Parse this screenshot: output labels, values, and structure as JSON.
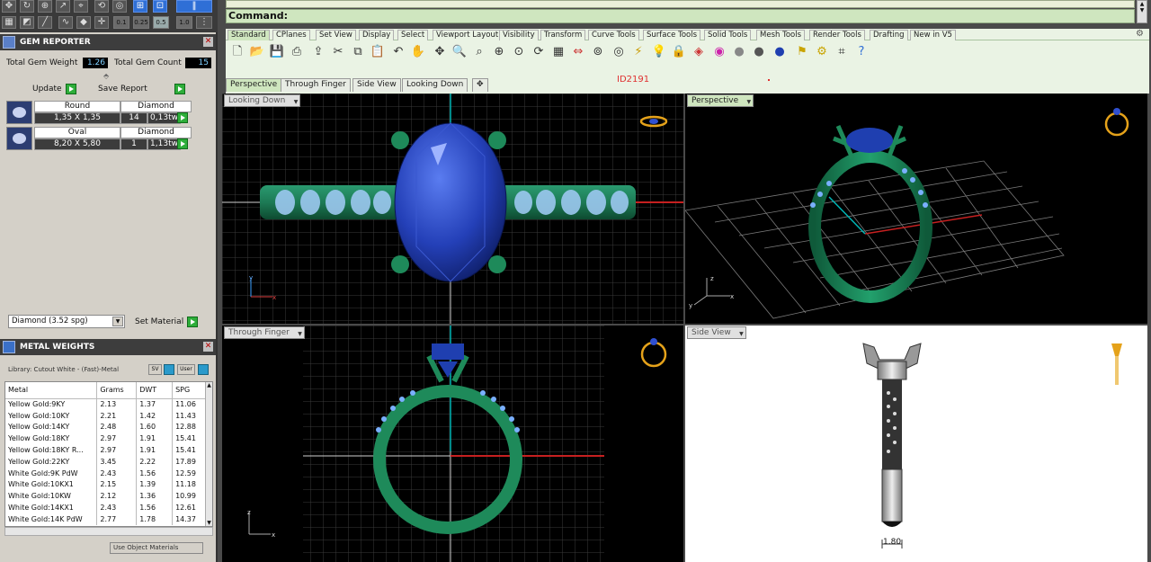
{
  "gem_reporter": {
    "title": "GEM REPORTER",
    "total_weight_label": "Total Gem Weight",
    "total_weight_value": "1.26",
    "total_count_label": "Total Gem Count",
    "total_count_value": "15",
    "update_label": "Update",
    "save_report_label": "Save Report",
    "gems": [
      {
        "shape": "Round",
        "material": "Diamond",
        "size": "1,35 X 1,35",
        "count": "14",
        "weight": "0,13tw"
      },
      {
        "shape": "Oval",
        "material": "Diamond",
        "size": "8,20 X 5,80",
        "count": "1",
        "weight": "1,13tw"
      }
    ],
    "material_select": "Diamond    (3.52 spg)",
    "set_material_label": "Set Material"
  },
  "metal_weights": {
    "title": "METAL WEIGHTS",
    "library_label": "Library: Cutout White - (Fast)-Metal",
    "btn_sv": "SV",
    "btn_user": "User",
    "columns": [
      "Metal",
      "Grams",
      "DWT",
      "SPG"
    ],
    "rows": [
      [
        "Yellow Gold:9KY",
        "2.13",
        "1.37",
        "11.06"
      ],
      [
        "Yellow Gold:10KY",
        "2.21",
        "1.42",
        "11.43"
      ],
      [
        "Yellow Gold:14KY",
        "2.48",
        "1.60",
        "12.88"
      ],
      [
        "Yellow Gold:18KY",
        "2.97",
        "1.91",
        "15.41"
      ],
      [
        "Yellow Gold:18KY R...",
        "2.97",
        "1.91",
        "15.41"
      ],
      [
        "Yellow Gold:22KY",
        "3.45",
        "2.22",
        "17.89"
      ],
      [
        "White Gold:9K PdW",
        "2.43",
        "1.56",
        "12.59"
      ],
      [
        "White Gold:10KX1",
        "2.15",
        "1.39",
        "11.18"
      ],
      [
        "White Gold:10KW",
        "2.12",
        "1.36",
        "10.99"
      ],
      [
        "White Gold:14KX1",
        "2.43",
        "1.56",
        "12.61"
      ],
      [
        "White Gold:14K PdW",
        "2.77",
        "1.78",
        "14.37"
      ]
    ],
    "use_object_materials": "Use Object Materials"
  },
  "top_tools": {
    "val_a": "0.1",
    "val_b": "0.25",
    "val_c": "0.5",
    "val_d": "1.0"
  },
  "command": {
    "label": "Command:"
  },
  "toolbar_tabs": [
    "Standard",
    "CPlanes",
    "Set View",
    "Display",
    "Select",
    "Viewport Layout",
    "Visibility",
    "Transform",
    "Curve Tools",
    "Surface Tools",
    "Solid Tools",
    "Mesh Tools",
    "Render Tools",
    "Drafting",
    "New in V5"
  ],
  "viewport_tabs": [
    "Perspective",
    "Through Finger",
    "Side View",
    "Looking Down"
  ],
  "id_label": "ID2191",
  "viewports": {
    "top_left": "Looking Down",
    "top_right": "Perspective",
    "bottom_left": "Through Finger",
    "bottom_right": "Side View"
  },
  "dimension": "1.80",
  "colors": {
    "metal": "#1e8a5a",
    "gem": "#1f3fb0",
    "panel": "#d4d0c8",
    "accent_green": "#2eae3a"
  }
}
